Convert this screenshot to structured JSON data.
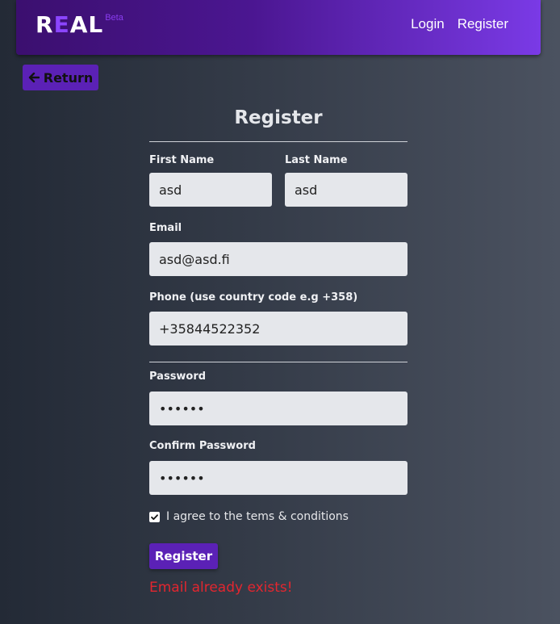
{
  "navbar": {
    "logo": {
      "part1": "R",
      "accent": "E",
      "part2": "AL",
      "badge": "Beta"
    },
    "links": {
      "login": "Login",
      "register": "Register"
    }
  },
  "return_button": {
    "label": "Return",
    "icon": "arrow-left-icon"
  },
  "form": {
    "title": "Register",
    "first_name": {
      "label": "First Name",
      "value": "asd"
    },
    "last_name": {
      "label": "Last Name",
      "value": "asd"
    },
    "email": {
      "label": "Email",
      "value": "asd@asd.fi"
    },
    "phone": {
      "label": "Phone (use country code e.g +358)",
      "value": "+35844522352"
    },
    "password": {
      "label": "Password",
      "value": "••••••"
    },
    "confirm_password": {
      "label": "Confirm Password",
      "value": "••••••"
    },
    "terms": {
      "label": "I agree to the tems & conditions",
      "checked": true
    },
    "submit_label": "Register",
    "error": "Email already exists!"
  },
  "colors": {
    "accent": "#5b21b6",
    "navbar_start": "#3b0f6f",
    "navbar_end": "#7a3ae6",
    "error": "#e3262f",
    "input_bg": "#e5e7eb"
  }
}
